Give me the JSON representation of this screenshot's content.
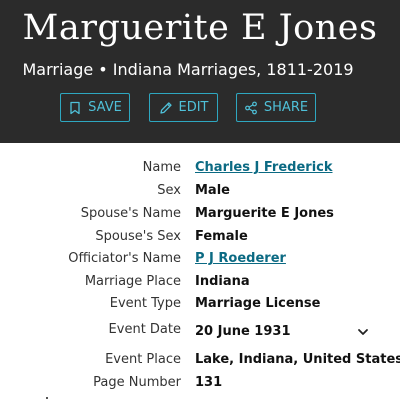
{
  "record": {
    "title": "Marguerite E Jones",
    "subtitle": "Marriage • Indiana Marriages, 1811-2019"
  },
  "actions": {
    "save": "SAVE",
    "edit": "EDIT",
    "share": "SHARE"
  },
  "fields": [
    {
      "label": "Name",
      "value": "Charles J Frederick"
    },
    {
      "label": "Sex",
      "value": "Male"
    },
    {
      "label": "Spouse's Name",
      "value": "Marguerite E Jones"
    },
    {
      "label": "Spouse's Sex",
      "value": "Female"
    },
    {
      "label": "Officiator's Name",
      "value": "P J Roederer"
    },
    {
      "label": "Marriage Place",
      "value": "Indiana"
    },
    {
      "label": "Event Type",
      "value": "Marriage License"
    },
    {
      "label": "Event Date",
      "value": "20 June 1931"
    },
    {
      "label": "Event Place",
      "value": "Lake, Indiana, United States"
    },
    {
      "label": "Page Number",
      "value": "131"
    }
  ]
}
